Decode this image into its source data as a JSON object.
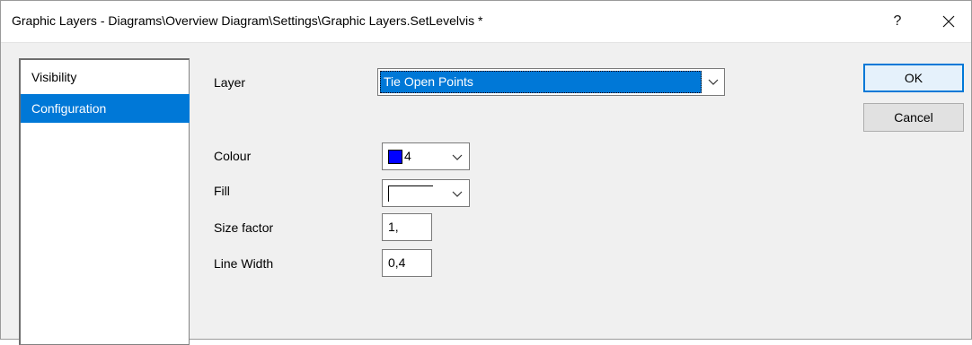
{
  "window": {
    "title": "Graphic Layers - Diagrams\\Overview Diagram\\Settings\\Graphic Layers.SetLevelvis *",
    "help_label": "?",
    "close_icon": "close-icon"
  },
  "nav": {
    "items": [
      {
        "label": "Visibility",
        "selected": false
      },
      {
        "label": "Configuration",
        "selected": true
      }
    ]
  },
  "form": {
    "layer_label": "Layer",
    "layer_value": "Tie Open Points",
    "colour_label": "Colour",
    "colour_value": "4",
    "colour_swatch": "#0000ff",
    "fill_label": "Fill",
    "size_factor_label": "Size factor",
    "size_factor_value": "1,",
    "line_width_label": "Line Width",
    "line_width_value": "0,4"
  },
  "buttons": {
    "ok": "OK",
    "cancel": "Cancel"
  },
  "colors": {
    "accent": "#0078d7",
    "window_bg": "#f0f0f0"
  }
}
